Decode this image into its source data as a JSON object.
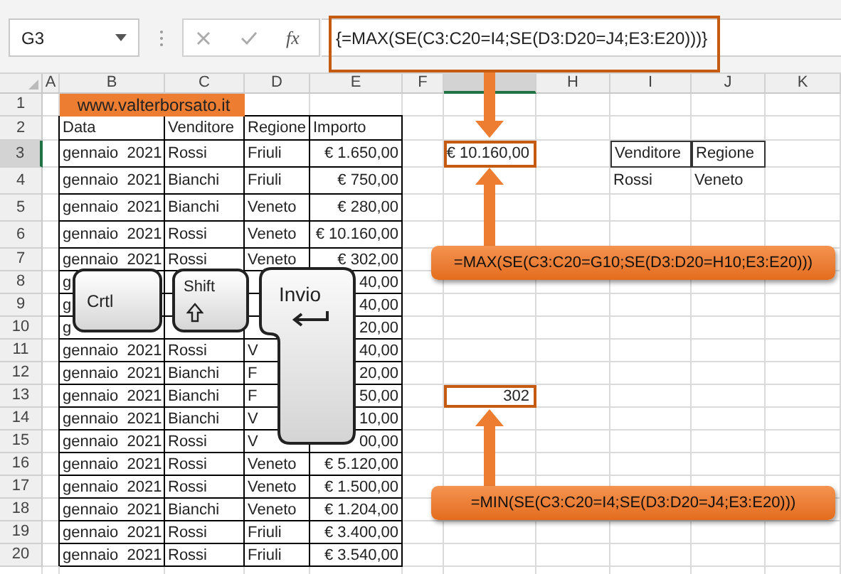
{
  "formula_bar": {
    "name_box": "G3",
    "fx_label": "fx",
    "formula": "{=MAX(SE(C3:C20=I4;SE(D3:D20=J4;E3:E20)))}"
  },
  "columns": [
    {
      "label": "A",
      "selected": false
    },
    {
      "label": "B",
      "selected": false
    },
    {
      "label": "C",
      "selected": false
    },
    {
      "label": "D",
      "selected": false
    },
    {
      "label": "E",
      "selected": false
    },
    {
      "label": "F",
      "selected": false
    },
    {
      "selected": true
    },
    {
      "label": "H",
      "selected": false
    },
    {
      "label": "I",
      "selected": false
    },
    {
      "label": "J",
      "selected": false
    },
    {
      "label": "K",
      "selected": false
    }
  ],
  "rows": [
    {
      "label": "1",
      "selected": false
    },
    {
      "label": "2",
      "selected": false
    },
    {
      "label": "3",
      "selected": true
    },
    {
      "label": "4",
      "selected": false
    },
    {
      "label": "5",
      "selected": false
    },
    {
      "label": "6",
      "selected": false
    },
    {
      "label": "7",
      "selected": false
    },
    {
      "label": "8",
      "selected": false
    },
    {
      "label": "9",
      "selected": false
    },
    {
      "label": "10",
      "selected": false
    },
    {
      "label": "11",
      "selected": false
    },
    {
      "label": "12",
      "selected": false
    },
    {
      "label": "13",
      "selected": false
    },
    {
      "label": "14",
      "selected": false
    },
    {
      "label": "15",
      "selected": false
    },
    {
      "label": "16",
      "selected": false
    },
    {
      "label": "17",
      "selected": false
    },
    {
      "label": "18",
      "selected": false
    },
    {
      "label": "19",
      "selected": false
    },
    {
      "label": "20",
      "selected": false
    }
  ],
  "banner": "www.valterborsato.it",
  "table": {
    "columns": [
      "Data",
      "Venditore",
      "Regione",
      "Importo"
    ],
    "rows": [
      [
        "gennaio  2021",
        "Rossi",
        "Friuli",
        "€ 1.650,00"
      ],
      [
        "gennaio  2021",
        "Bianchi",
        "Friuli",
        "€ 750,00"
      ],
      [
        "gennaio  2021",
        "Bianchi",
        "Veneto",
        "€ 280,00"
      ],
      [
        "gennaio  2021",
        "Rossi",
        "Veneto",
        "€ 10.160,00"
      ],
      [
        "gennaio  2021",
        "Rossi",
        "Veneto",
        "€ 302,00"
      ],
      [
        "g",
        "",
        "",
        "40,00"
      ],
      [
        "g",
        "",
        "",
        "40,00"
      ],
      [
        "g",
        "",
        "",
        "20,00"
      ],
      [
        "gennaio  2021",
        "Rossi",
        "V",
        "40,00"
      ],
      [
        "gennaio  2021",
        "Bianchi",
        "F",
        "20,00"
      ],
      [
        "gennaio  2021",
        "Bianchi",
        "F",
        "50,00"
      ],
      [
        "gennaio  2021",
        "Bianchi",
        "V",
        "10,00"
      ],
      [
        "gennaio  2021",
        "Rossi",
        "V",
        "00,00"
      ],
      [
        "gennaio  2021",
        "Rossi",
        "Veneto",
        "€ 5.120,00"
      ],
      [
        "gennaio  2021",
        "Rossi",
        "Veneto",
        "€ 1.500,00"
      ],
      [
        "gennaio  2021",
        "Bianchi",
        "Veneto",
        "€ 1.204,00"
      ],
      [
        "gennaio  2021",
        "Rossi",
        "Friuli",
        "€ 3.400,00"
      ],
      [
        "gennaio  2021",
        "Rossi",
        "Friuli",
        "€ 3.540,00"
      ]
    ]
  },
  "results": [
    "€ 10.160,00",
    "302"
  ],
  "criteria": {
    "columns": [
      "Venditore",
      "Regione"
    ],
    "values": [
      "Rossi",
      "Veneto"
    ]
  },
  "callouts": [
    "=MAX(SE(C3:C20=G10;SE(D3:D20=H10;E3:E20)))",
    "=MIN(SE(C3:C20=I4;SE(D3:D20=J4;E3:E20)))"
  ],
  "keys": [
    {
      "kind": "plain",
      "label": "Crtl"
    },
    {
      "kind": "shift",
      "label": "Shift"
    },
    {
      "kind": "enter",
      "label": "Invio"
    }
  ]
}
